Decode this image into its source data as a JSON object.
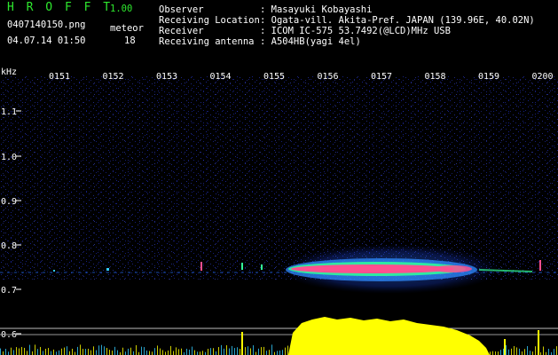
{
  "app": {
    "name": "H R O F F T",
    "version": "1.00"
  },
  "file": {
    "name": "0407140150.png",
    "datetime": "04.07.14 01:50"
  },
  "detection": {
    "label": "meteor",
    "count": "18"
  },
  "info": {
    "observer_label": "Observer",
    "observer_value": ": Masayuki Kobayashi",
    "location_label": "Receiving Location",
    "location_value": ": Ogata-vill. Akita-Pref. JAPAN (139.96E, 40.02N)",
    "receiver_label": "Receiver",
    "receiver_value": ": ICOM IC-575 53.7492(@LCD)MHz USB",
    "antenna_label": "Receiving antenna",
    "antenna_value": ": A504HB(yagi 4el)"
  },
  "axis": {
    "unit": "kHz",
    "time_ticks": [
      "0151",
      "0152",
      "0153",
      "0154",
      "0155",
      "0156",
      "0157",
      "0158",
      "0159",
      "0200"
    ],
    "freq_ticks": [
      "1.1",
      "1.0",
      "0.9",
      "0.8",
      "0.7",
      "0.6"
    ]
  },
  "colors": {
    "background": "#000000",
    "header_green": "#2ee82e",
    "axis_text": "#ffffff",
    "echo_core": "#ff4f8f",
    "echo_mid": "#33ff99",
    "echo_outer": "#2f8bff",
    "level_bars": "#ffff00"
  }
}
